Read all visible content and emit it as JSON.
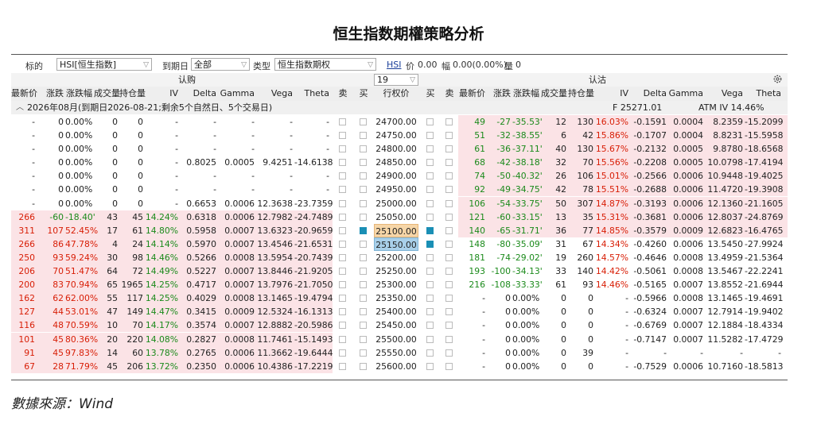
{
  "title": "恒生指数期權策略分析",
  "source": "數據來源：Wind",
  "toolbar": {
    "target_label": "标的",
    "target_value": "HSI[恒生指数]",
    "expiry_label": "到期日",
    "expiry_value": "全部",
    "type_label": "类型",
    "type_value": "恒生指数期权",
    "ticker": "HSI",
    "price_label": "价",
    "price_value": "0.00",
    "change_label": "幅",
    "change_value": "0.00(0.00%)",
    "volume_label": "量",
    "volume_value": "0"
  },
  "bar2": {
    "call_label": "认购",
    "put_label": "认沽",
    "count_value": "19"
  },
  "headers": {
    "call": [
      "最新价",
      "涨跌",
      "涨跌幅",
      "成交量",
      "持仓量",
      "IV",
      "Delta",
      "Gamma",
      "Vega",
      "Theta",
      "卖",
      "买"
    ],
    "strike": "行权价",
    "put": [
      "买",
      "卖",
      "最新价",
      "涨跌",
      "涨跌幅",
      "成交量",
      "持仓量",
      "IV",
      "Delta",
      "Gamma",
      "Vega",
      "Theta"
    ]
  },
  "group": {
    "label": "2026年08月(到期日2026-08-21;剩余5个自然日、5个交易日)",
    "future": "F  25271.01",
    "atm_iv": "ATM IV 14.46%"
  },
  "rows": [
    {
      "strike": "24700.00",
      "call": [
        "-",
        "0",
        "0.00%",
        "0",
        "0",
        "-",
        "-",
        "-",
        "-",
        "-"
      ],
      "put": [
        "49",
        "-27",
        "-35.53'",
        "12",
        "130",
        "16.03%",
        "-0.1591",
        "0.0004",
        "8.2359",
        "-15.2099"
      ]
    },
    {
      "strike": "24750.00",
      "call": [
        "-",
        "0",
        "0.00%",
        "0",
        "0",
        "-",
        "-",
        "-",
        "-",
        "-"
      ],
      "put": [
        "51",
        "-32",
        "-38.55'",
        "6",
        "42",
        "15.86%",
        "-0.1707",
        "0.0004",
        "8.8231",
        "-15.5958"
      ]
    },
    {
      "strike": "24800.00",
      "call": [
        "-",
        "0",
        "0.00%",
        "0",
        "0",
        "-",
        "-",
        "-",
        "-",
        "-"
      ],
      "put": [
        "61",
        "-36",
        "-37.11'",
        "40",
        "130",
        "15.67%",
        "-0.2132",
        "0.0005",
        "9.8780",
        "-18.6568"
      ]
    },
    {
      "strike": "24850.00",
      "call": [
        "-",
        "0",
        "0.00%",
        "0",
        "0",
        "-",
        "0.8025",
        "0.0005",
        "9.4251",
        "-14.6138"
      ],
      "put": [
        "68",
        "-42",
        "-38.18'",
        "32",
        "70",
        "15.56%",
        "-0.2208",
        "0.0005",
        "10.0798",
        "-17.4194"
      ]
    },
    {
      "strike": "24900.00",
      "call": [
        "-",
        "0",
        "0.00%",
        "0",
        "0",
        "-",
        "-",
        "-",
        "-",
        "-"
      ],
      "put": [
        "74",
        "-50",
        "-40.32'",
        "26",
        "106",
        "15.01%",
        "-0.2566",
        "0.0006",
        "10.9448",
        "-19.4025"
      ]
    },
    {
      "strike": "24950.00",
      "call": [
        "-",
        "0",
        "0.00%",
        "0",
        "0",
        "-",
        "-",
        "-",
        "-",
        "-"
      ],
      "put": [
        "92",
        "-49",
        "-34.75'",
        "42",
        "78",
        "15.51%",
        "-0.2688",
        "0.0006",
        "11.4720",
        "-19.3908"
      ]
    },
    {
      "strike": "25000.00",
      "call": [
        "-",
        "0",
        "0.00%",
        "0",
        "0",
        "-",
        "0.6653",
        "0.0006",
        "12.3638",
        "-23.7359"
      ],
      "put": [
        "106",
        "-54",
        "-33.75'",
        "50",
        "307",
        "14.87%",
        "-0.3193",
        "0.0006",
        "12.1360",
        "-21.1605"
      ]
    },
    {
      "strike": "25050.00",
      "call": [
        "266",
        "-60",
        "-18.40'",
        "43",
        "45",
        "14.24%",
        "0.6318",
        "0.0006",
        "12.7982",
        "-24.7489"
      ],
      "put": [
        "121",
        "-60",
        "-33.15'",
        "13",
        "35",
        "15.31%",
        "-0.3681",
        "0.0006",
        "12.8037",
        "-24.8769"
      ]
    },
    {
      "strike": "25100.00",
      "call": [
        "311",
        "107",
        "52.45%",
        "17",
        "61",
        "14.80%",
        "0.5958",
        "0.0007",
        "13.6323",
        "-20.9659"
      ],
      "put": [
        "140",
        "-65",
        "-31.71'",
        "36",
        "77",
        "14.85%",
        "-0.3579",
        "0.0009",
        "12.6823",
        "-16.4765"
      ]
    },
    {
      "strike": "25150.00",
      "call": [
        "266",
        "86",
        "47.78%",
        "4",
        "24",
        "14.14%",
        "0.5970",
        "0.0007",
        "13.4546",
        "-21.6531"
      ],
      "put": [
        "148",
        "-80",
        "-35.09'",
        "31",
        "67",
        "14.34%",
        "-0.4260",
        "0.0006",
        "13.5450",
        "-27.9924"
      ]
    },
    {
      "strike": "25200.00",
      "call": [
        "250",
        "93",
        "59.24%",
        "30",
        "98",
        "14.46%",
        "0.5266",
        "0.0008",
        "13.5954",
        "-20.7439"
      ],
      "put": [
        "181",
        "-74",
        "-29.02'",
        "19",
        "260",
        "14.57%",
        "-0.4646",
        "0.0008",
        "13.4959",
        "-21.5364"
      ]
    },
    {
      "strike": "25250.00",
      "call": [
        "206",
        "70",
        "51.47%",
        "64",
        "72",
        "14.49%",
        "0.5227",
        "0.0007",
        "13.8446",
        "-21.9205"
      ],
      "put": [
        "193",
        "-100",
        "-34.13'",
        "33",
        "140",
        "14.42%",
        "-0.5061",
        "0.0008",
        "13.5467",
        "-22.2241"
      ]
    },
    {
      "strike": "25300.00",
      "call": [
        "200",
        "83",
        "70.94%",
        "65",
        "1965",
        "14.25%",
        "0.4717",
        "0.0007",
        "13.7976",
        "-21.7050"
      ],
      "put": [
        "216",
        "-108",
        "-33.33'",
        "61",
        "93",
        "14.46%",
        "-0.5165",
        "0.0007",
        "13.8552",
        "-21.6944"
      ]
    },
    {
      "strike": "25350.00",
      "call": [
        "162",
        "62",
        "62.00%",
        "55",
        "117",
        "14.25%",
        "0.4029",
        "0.0008",
        "13.1465",
        "-19.4794"
      ],
      "put": [
        "-",
        "0",
        "0.00%",
        "0",
        "0",
        "-",
        "-0.5966",
        "0.0008",
        "13.1465",
        "-19.4691"
      ]
    },
    {
      "strike": "25400.00",
      "call": [
        "127",
        "44",
        "53.01%",
        "47",
        "149",
        "14.47%",
        "0.3415",
        "0.0009",
        "12.5324",
        "-16.1313"
      ],
      "put": [
        "-",
        "0",
        "0.00%",
        "0",
        "0",
        "-",
        "-0.6324",
        "0.0007",
        "12.7914",
        "-19.9402"
      ]
    },
    {
      "strike": "25450.00",
      "call": [
        "116",
        "48",
        "70.59%",
        "10",
        "70",
        "14.17%",
        "0.3574",
        "0.0007",
        "12.8882",
        "-20.5986"
      ],
      "put": [
        "-",
        "0",
        "0.00%",
        "0",
        "0",
        "-",
        "-0.6769",
        "0.0007",
        "12.1884",
        "-18.4334"
      ]
    },
    {
      "strike": "25500.00",
      "call": [
        "101",
        "45",
        "80.36%",
        "20",
        "220",
        "14.08%",
        "0.2827",
        "0.0008",
        "11.7461",
        "-15.1493"
      ],
      "put": [
        "-",
        "0",
        "0.00%",
        "0",
        "0",
        "-",
        "-0.7147",
        "0.0007",
        "11.5282",
        "-17.4729"
      ]
    },
    {
      "strike": "25550.00",
      "call": [
        "91",
        "45",
        "97.83%",
        "14",
        "60",
        "13.78%",
        "0.2765",
        "0.0006",
        "11.3662",
        "-19.6444"
      ],
      "put": [
        "-",
        "0",
        "0.00%",
        "0",
        "39",
        "-",
        "-",
        "-",
        "-",
        "-"
      ]
    },
    {
      "strike": "25600.00",
      "call": [
        "67",
        "28",
        "71.79%",
        "45",
        "206",
        "13.72%",
        "0.2350",
        "0.0006",
        "10.4386",
        "-17.2219"
      ],
      "put": [
        "-",
        "0",
        "0.00%",
        "0",
        "0",
        "-",
        "-0.7529",
        "0.0006",
        "10.7160",
        "-18.5813"
      ]
    }
  ],
  "checked": {
    "call_buy_row": 8,
    "put_buy_rows": [
      8,
      9
    ]
  },
  "highlight": {
    "orange_strike_row": 8,
    "blue_strike_row": 9
  }
}
